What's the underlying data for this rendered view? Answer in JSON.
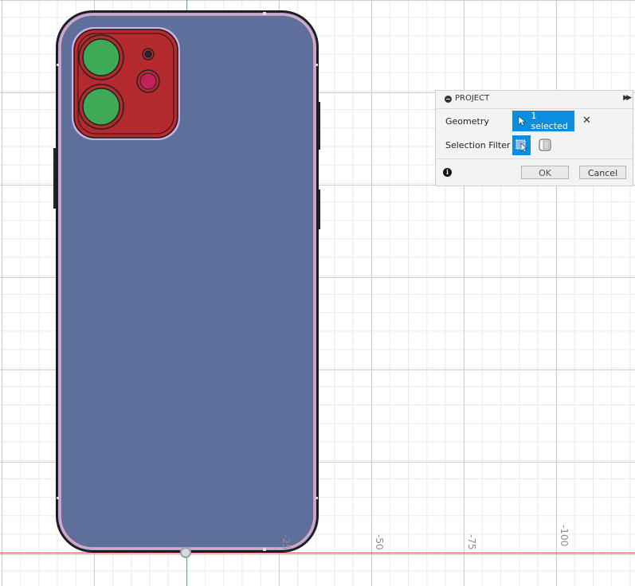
{
  "panel": {
    "title": "PROJECT",
    "geometry_label": "Geometry",
    "geometry_value": "1 selected",
    "selection_filter_label": "Selection Filter",
    "ok_label": "OK",
    "cancel_label": "Cancel",
    "info_glyph": "i"
  },
  "ruler": {
    "ticks": [
      "-25",
      "-50",
      "-75",
      "-100"
    ]
  },
  "colors": {
    "body_fill": "#5f6f9b",
    "camera_module": "#b52a2e",
    "lens": "#3faa55",
    "flash": "#c2205a",
    "selection_blue": "#0c8ddf",
    "x_axis": "#e0555c",
    "y_axis": "#47b96d"
  },
  "icons": [
    "collapse-icon",
    "expand-icon",
    "cursor-icon",
    "clear-icon",
    "select-body-icon",
    "select-face-icon",
    "info-icon"
  ]
}
